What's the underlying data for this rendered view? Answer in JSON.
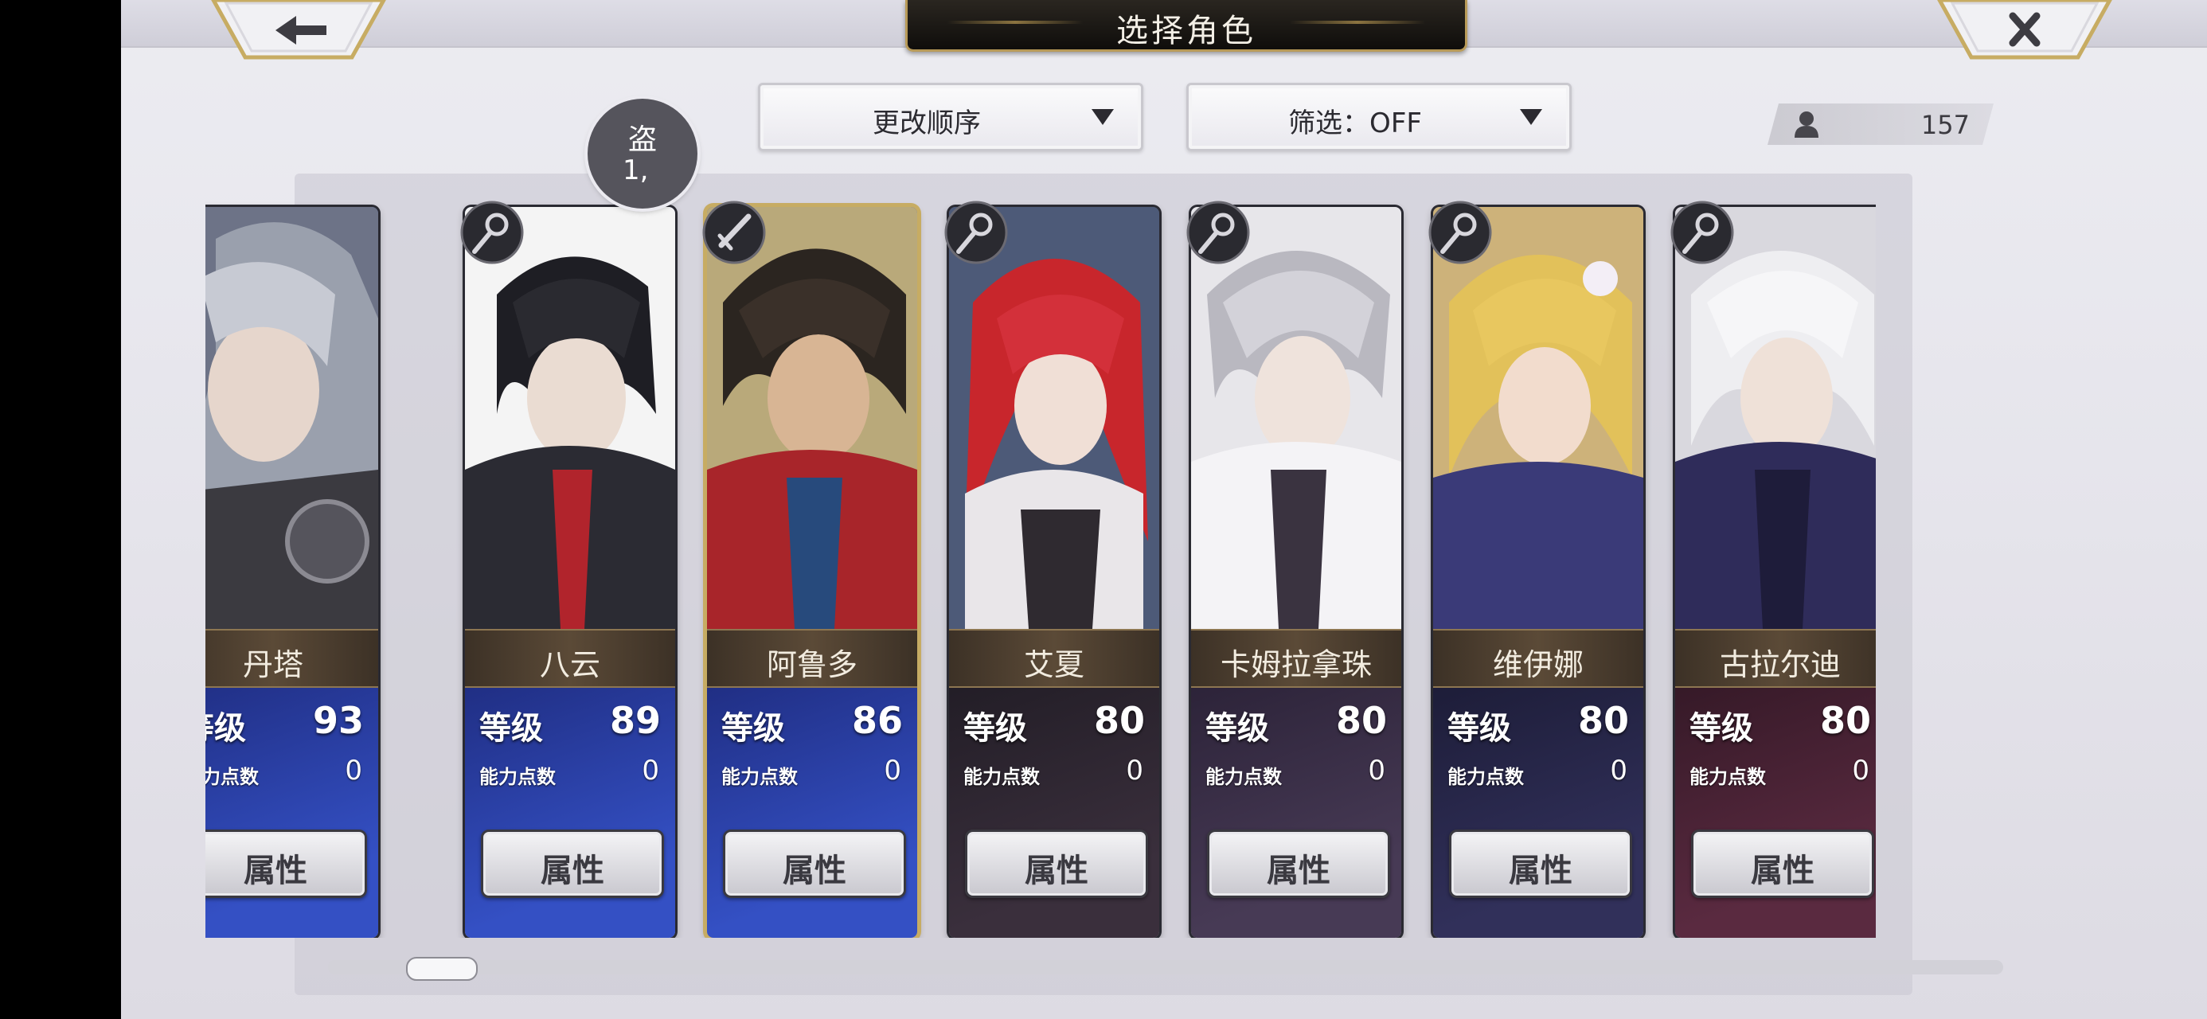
{
  "header": {
    "title": "选择角色"
  },
  "controls": {
    "sort_label": "更改顺序",
    "filter_label": "筛选：OFF",
    "character_count": "157"
  },
  "tooltip": {
    "line1": "盗",
    "line2": "1,"
  },
  "labels": {
    "level": "等级",
    "ability_points": "能力点数",
    "attributes": "属性"
  },
  "characters": [
    {
      "name": "丹塔",
      "level": "93",
      "ability_points": "0",
      "class_icon": "staff-icon"
    },
    {
      "name": "八云",
      "level": "89",
      "ability_points": "0",
      "class_icon": "staff-icon"
    },
    {
      "name": "阿鲁多",
      "level": "86",
      "ability_points": "0",
      "class_icon": "sword-icon"
    },
    {
      "name": "艾夏",
      "level": "80",
      "ability_points": "0",
      "class_icon": "staff-icon"
    },
    {
      "name": "卡姆拉拿珠",
      "level": "80",
      "ability_points": "0",
      "class_icon": "staff-icon"
    },
    {
      "name": "维伊娜",
      "level": "80",
      "ability_points": "0",
      "class_icon": "staff-icon"
    },
    {
      "name": "古拉尔迪",
      "level": "80",
      "ability_points": "0",
      "class_icon": "staff-icon"
    },
    {
      "name": "",
      "level": "",
      "ability_points": "",
      "class_icon": "staff-icon"
    }
  ],
  "colors": {
    "title_plate": "#1a1713",
    "gold_trim": "#b89a58",
    "button_text": "#3a3940"
  }
}
